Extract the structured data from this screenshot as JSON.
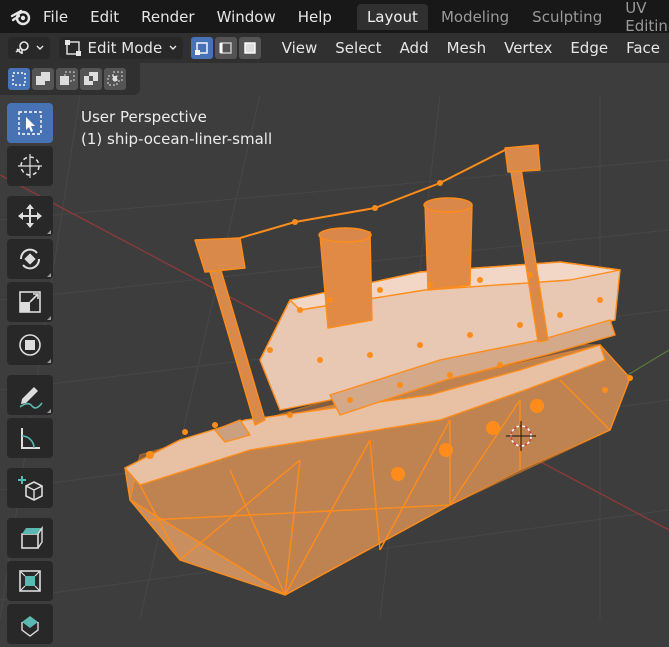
{
  "menubar": {
    "logo_icon": "blender-logo-icon",
    "items": [
      "File",
      "Edit",
      "Render",
      "Window",
      "Help"
    ],
    "workspaces": [
      "Layout",
      "Modeling",
      "Sculpting",
      "UV Editing"
    ],
    "active_workspace": "Layout"
  },
  "header": {
    "editor_type_icon": "3d-viewport-icon",
    "mode_label": "Edit Mode",
    "menus": [
      "View",
      "Select",
      "Add",
      "Mesh",
      "Vertex",
      "Edge",
      "Face"
    ],
    "select_modes": [
      "vertex-select-icon",
      "edge-select-icon",
      "face-select-icon"
    ]
  },
  "viewport": {
    "view_name": "User Perspective",
    "object_name": "(1) ship-ocean-liner-small",
    "background_color": "#3d3d3d",
    "selection_color": "#ff8c1a"
  },
  "toolshelf": {
    "tools": [
      "select-box-icon",
      "cursor-icon",
      "move-icon",
      "rotate-icon",
      "scale-icon",
      "transform-icon",
      "annotate-icon",
      "measure-icon",
      "add-cube-icon",
      "extrude-icon",
      "inset-icon",
      "bevel-icon"
    ]
  }
}
